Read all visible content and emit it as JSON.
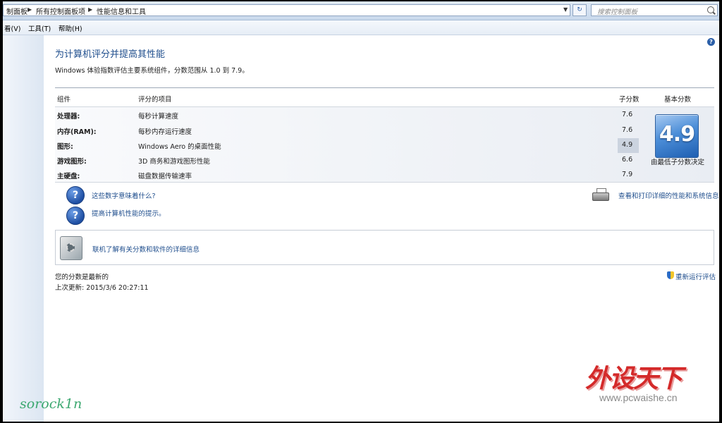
{
  "addressbar": {
    "breadcrumb": [
      "制面板",
      "所有控制面板项",
      "性能信息和工具"
    ],
    "search_placeholder": "搜索控制面板"
  },
  "menubar": {
    "items": [
      "看(V)",
      "工具(T)",
      "帮助(H)"
    ]
  },
  "main": {
    "title": "为计算机评分并提高其性能",
    "description": "Windows 体验指数评估主要系统组件，分数范围从 1.0 到 7.9。",
    "table": {
      "headers": {
        "component": "组件",
        "rated": "评分的项目",
        "subscore": "子分数",
        "base": "基本分数"
      },
      "rows": [
        {
          "component": "处理器:",
          "item": "每秒计算速度",
          "subscore": "7.6"
        },
        {
          "component": "内存(RAM):",
          "item": "每秒内存运行速度",
          "subscore": "7.6"
        },
        {
          "component": "图形:",
          "item": "Windows Aero 的桌面性能",
          "subscore": "4.9"
        },
        {
          "component": "游戏图形:",
          "item": "3D 商务和游戏图形性能",
          "subscore": "6.6"
        },
        {
          "component": "主硬盘:",
          "item": "磁盘数据传输速率",
          "subscore": "7.9"
        }
      ],
      "base_score": "4.9",
      "base_caption": "由最低子分数决定"
    },
    "links": {
      "meaning": "这些数字意味着什么?",
      "tips": "提高计算机性能的提示。",
      "print": "查看和打印详细的性能和系统信息",
      "online": "联机了解有关分数和软件的详细信息"
    },
    "status": {
      "current": "您的分数是最新的",
      "last_update": "上次更新: 2015/3/6 20:27:11",
      "rerun": "重新运行评估"
    }
  },
  "overlay": {
    "watermark_logo": "外设天下",
    "watermark_url": "www.pcwaishe.cn",
    "signature": "sorock1n"
  }
}
